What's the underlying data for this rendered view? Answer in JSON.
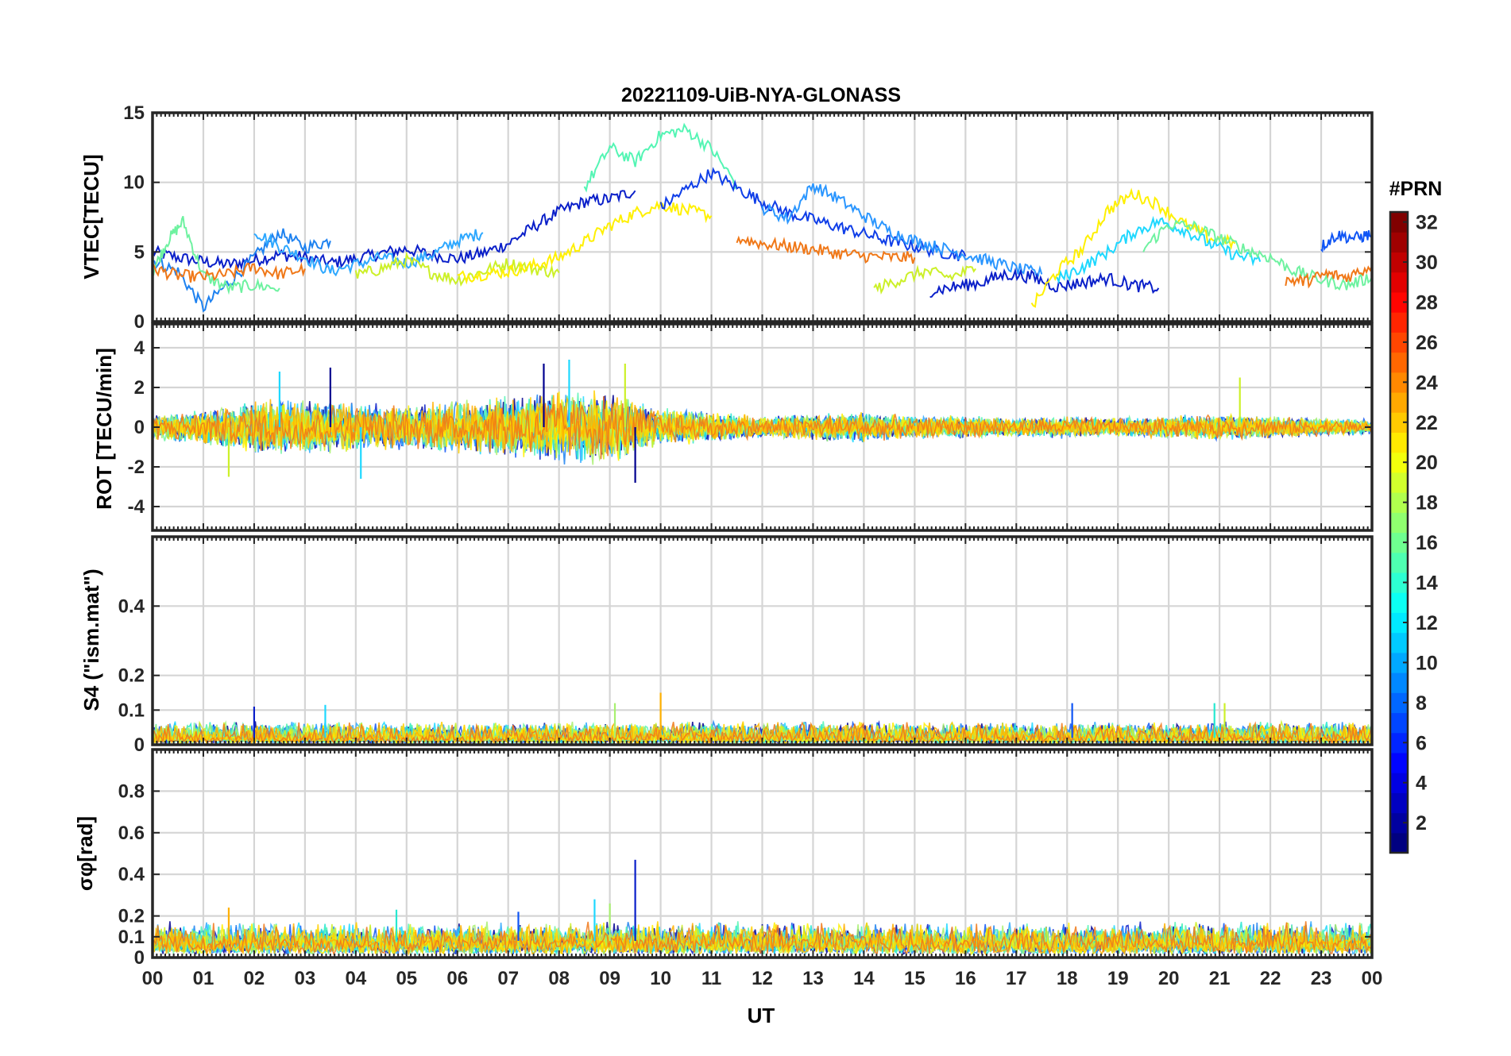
{
  "figure": {
    "title": "20221109-UiB-NYA-GLONASS",
    "xlabel": "UT",
    "x_tick_labels": [
      "00",
      "01",
      "02",
      "03",
      "04",
      "05",
      "06",
      "07",
      "08",
      "09",
      "10",
      "11",
      "12",
      "13",
      "14",
      "15",
      "16",
      "17",
      "18",
      "19",
      "20",
      "21",
      "22",
      "23",
      "00"
    ]
  },
  "colorbar": {
    "label": "#PRN",
    "range": [
      1,
      32
    ],
    "tick_labels": [
      "2",
      "4",
      "6",
      "8",
      "10",
      "12",
      "14",
      "16",
      "18",
      "20",
      "22",
      "24",
      "26",
      "28",
      "30",
      "32"
    ],
    "colormap": "jet"
  },
  "chart_data": [
    {
      "type": "line",
      "panel": "vtec",
      "ylabel": "VTEC[TECU]",
      "xlim": [
        0,
        24
      ],
      "ylim": [
        0,
        15
      ],
      "y_ticks": [
        0,
        5,
        10,
        15
      ],
      "grid": true,
      "series": [
        {
          "color": "#0a1fc9",
          "x": [
            0,
            0.5,
            1,
            1.5,
            2,
            2.5,
            3,
            3.5,
            4,
            4.5,
            5,
            5.5,
            6,
            6.5,
            7,
            7.5,
            8,
            8.5,
            9,
            9.5
          ],
          "y": [
            5,
            4.6,
            4.3,
            4.1,
            4.4,
            4.8,
            4.6,
            4.2,
            4.5,
            4.9,
            5.2,
            4.8,
            4.5,
            4.9,
            5.6,
            6.8,
            7.9,
            8.6,
            8.8,
            9.4
          ]
        },
        {
          "color": "#1e82f0",
          "x": [
            0,
            0.5,
            1,
            1.5,
            2,
            2.5,
            3,
            3.5
          ],
          "y": [
            4.4,
            3.6,
            1.0,
            2.8,
            4.6,
            6.4,
            5.3,
            5.8
          ]
        },
        {
          "color": "#2ea8ff",
          "x": [
            2,
            2.5,
            3,
            3.5,
            4,
            4.5,
            5,
            5.5,
            6,
            6.5
          ],
          "y": [
            6.5,
            5.4,
            4.6,
            3.6,
            4.1,
            4.6,
            4.2,
            4.8,
            5.8,
            6.4
          ]
        },
        {
          "color": "#6ef2a0",
          "x": [
            0,
            0.3,
            0.6,
            1,
            1.5,
            2,
            2.5
          ],
          "y": [
            3.6,
            5.8,
            7.2,
            3.3,
            2.4,
            2.6,
            2.4
          ]
        },
        {
          "color": "#f07818",
          "x": [
            0,
            0.5,
            1,
            1.5,
            2,
            2.5,
            3
          ],
          "y": [
            3.8,
            3.3,
            3.2,
            3.4,
            3.9,
            3.4,
            3.8
          ]
        },
        {
          "color": "#ccf028",
          "x": [
            4,
            4.5,
            5,
            5.5,
            6,
            6.5,
            7,
            7.5,
            8
          ],
          "y": [
            3.3,
            3.8,
            4.4,
            3.5,
            3.0,
            3.6,
            4.2,
            3.8,
            3.5
          ]
        },
        {
          "color": "#fff000",
          "x": [
            6,
            6.5,
            7,
            7.5,
            8,
            8.5,
            9,
            9.5,
            10,
            10.5,
            11
          ],
          "y": [
            3.2,
            3.4,
            3.6,
            4.0,
            4.6,
            5.7,
            6.9,
            7.8,
            8.4,
            8.0,
            7.6
          ]
        },
        {
          "color": "#54f5b4",
          "x": [
            8.5,
            9,
            9.5,
            10,
            10.5,
            11,
            11.5
          ],
          "y": [
            9.6,
            12.5,
            11.5,
            13.4,
            13.8,
            12.4,
            9.8
          ]
        },
        {
          "color": "#0f3ee8",
          "x": [
            10,
            10.5,
            11,
            11.5,
            12,
            12.5,
            13,
            13.5,
            14,
            14.5,
            15,
            15.5,
            16
          ],
          "y": [
            8.2,
            9.5,
            10.7,
            9.6,
            8.6,
            7.8,
            7.3,
            6.8,
            6.3,
            5.8,
            5.4,
            5.0,
            4.7
          ]
        },
        {
          "color": "#2a96ff",
          "x": [
            12,
            12.5,
            13,
            13.5,
            14,
            14.5,
            15,
            15.5,
            16,
            16.5,
            17,
            17.5
          ],
          "y": [
            8.2,
            7.4,
            9.8,
            8.8,
            7.6,
            6.5,
            5.8,
            5.3,
            4.8,
            4.3,
            3.8,
            3.4
          ]
        },
        {
          "color": "#f07818",
          "x": [
            11.5,
            12,
            12.5,
            13,
            13.5,
            14,
            14.5,
            15
          ],
          "y": [
            6.0,
            5.6,
            5.4,
            5.2,
            4.9,
            4.7,
            4.6,
            4.6
          ]
        },
        {
          "color": "#ccf028",
          "x": [
            14.2,
            14.7,
            15.2,
            15.7,
            16.2
          ],
          "y": [
            2.3,
            3.0,
            3.6,
            3.2,
            3.8
          ]
        },
        {
          "color": "#0a1fc9",
          "x": [
            15.3,
            15.8,
            16.3,
            16.8,
            17.3,
            17.8,
            18.3,
            18.8,
            19.3,
            19.8
          ],
          "y": [
            2.2,
            2.5,
            2.8,
            3.4,
            3.2,
            2.5,
            2.8,
            3.1,
            2.6,
            2.4
          ]
        },
        {
          "color": "#fff000",
          "x": [
            17.3,
            17.8,
            18.3,
            18.8,
            19.3,
            19.8,
            20.3,
            20.8,
            21.3
          ],
          "y": [
            1.0,
            3.6,
            5.2,
            8.0,
            9.2,
            8.4,
            7.0,
            6.0,
            5.6
          ]
        },
        {
          "color": "#1ed8ff",
          "x": [
            17.8,
            18.3,
            18.8,
            19.3,
            19.8,
            20.3,
            20.8,
            21.3,
            21.8
          ],
          "y": [
            3.0,
            3.9,
            5.0,
            6.4,
            7.2,
            6.6,
            5.6,
            4.8,
            4.3
          ]
        },
        {
          "color": "#6ef2a0",
          "x": [
            19.5,
            20,
            20.5,
            21,
            21.5,
            22,
            22.5,
            23,
            23.5,
            24
          ],
          "y": [
            5.2,
            7.0,
            6.8,
            6.0,
            5.2,
            4.6,
            3.6,
            3.0,
            2.6,
            3.2
          ]
        },
        {
          "color": "#f07818",
          "x": [
            22.3,
            22.7,
            23.1,
            23.5,
            24
          ],
          "y": [
            3.0,
            2.9,
            3.4,
            3.2,
            4.0
          ]
        },
        {
          "color": "#0f55f5",
          "x": [
            23,
            23.3,
            23.7,
            24
          ],
          "y": [
            5.4,
            6.2,
            6.0,
            6.3
          ]
        }
      ]
    },
    {
      "type": "line",
      "panel": "rot",
      "ylabel": "ROT [TECU/min]",
      "xlim": [
        0,
        24
      ],
      "ylim": [
        -5.2,
        5.2
      ],
      "y_ticks": [
        -4,
        -2,
        0,
        2,
        4
      ],
      "grid": true,
      "noise_envelope": {
        "x": [
          0,
          1,
          2,
          3,
          4,
          5,
          6,
          7,
          8,
          9,
          10,
          11,
          12,
          13,
          14,
          15,
          16,
          17,
          18,
          19,
          20,
          21,
          22,
          23,
          24
        ],
        "amplitude": [
          0.7,
          0.9,
          1.4,
          1.5,
          1.3,
          1.2,
          1.4,
          1.6,
          2.0,
          1.9,
          1.0,
          0.8,
          0.6,
          0.7,
          0.8,
          0.6,
          0.6,
          0.5,
          0.6,
          0.5,
          0.6,
          0.7,
          0.6,
          0.5,
          0.4
        ]
      },
      "peaks": [
        {
          "x": 7.7,
          "y": 3.2
        },
        {
          "x": 8.2,
          "y": 3.4
        },
        {
          "x": 9.3,
          "y": 3.2
        },
        {
          "x": 3.5,
          "y": 3.0
        },
        {
          "x": 2.5,
          "y": 2.8
        },
        {
          "x": 21.4,
          "y": 2.5
        },
        {
          "x": 9.5,
          "y": -2.8
        },
        {
          "x": 4.1,
          "y": -2.6
        },
        {
          "x": 1.5,
          "y": -2.5
        }
      ]
    },
    {
      "type": "line",
      "panel": "s4",
      "ylabel": "S4 (\"ism.mat\")",
      "xlim": [
        0,
        24
      ],
      "ylim": [
        0,
        0.6
      ],
      "y_ticks": [
        0,
        0.1,
        0.2,
        0.4
      ],
      "grid": true,
      "baseline": 0.02,
      "noise_amplitude": 0.03,
      "peaks": [
        {
          "x": 2.0,
          "y": 0.11
        },
        {
          "x": 3.4,
          "y": 0.115
        },
        {
          "x": 9.1,
          "y": 0.12
        },
        {
          "x": 10.0,
          "y": 0.15
        },
        {
          "x": 18.1,
          "y": 0.12
        },
        {
          "x": 20.9,
          "y": 0.12
        },
        {
          "x": 21.1,
          "y": 0.12
        }
      ]
    },
    {
      "type": "line",
      "panel": "sigma_phi",
      "ylabel": "σφ[rad]",
      "xlim": [
        0,
        24
      ],
      "ylim": [
        0,
        1.0
      ],
      "y_ticks": [
        0,
        0.1,
        0.2,
        0.4,
        0.6,
        0.8
      ],
      "grid": true,
      "baseline": 0.08,
      "noise_amplitude": 0.06,
      "peaks": [
        {
          "x": 9.5,
          "y": 0.47
        },
        {
          "x": 8.7,
          "y": 0.28
        },
        {
          "x": 9.0,
          "y": 0.26
        },
        {
          "x": 1.5,
          "y": 0.24
        },
        {
          "x": 7.2,
          "y": 0.22
        },
        {
          "x": 4.8,
          "y": 0.23
        }
      ]
    }
  ]
}
